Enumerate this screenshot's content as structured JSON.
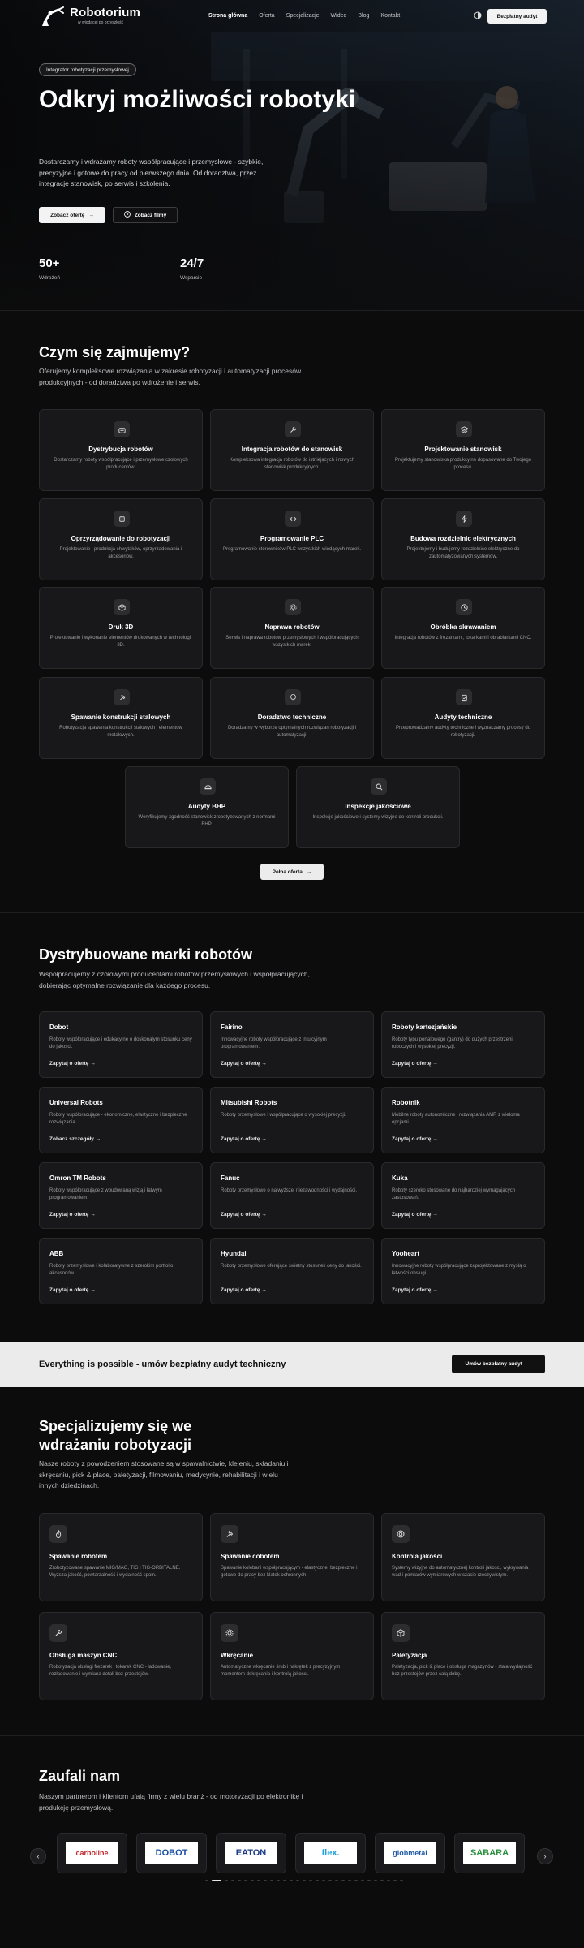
{
  "nav": {
    "logo_title": "Robotorium",
    "logo_sub": "w wiodącej po przyszłość",
    "links": [
      "Strona główna",
      "Oferta",
      "Specjalizacje",
      "Wideo",
      "Blog",
      "Kontakt"
    ],
    "cta": "Bezpłatny audyt"
  },
  "hero": {
    "badge": "Integrator robotyzacji przemysłowej",
    "title": "Odkryj możliwości robotyki",
    "description": "Dostarczamy i wdrażamy roboty współpracujące i przemysłowe - szybkie, precyzyjne i gotowe do pracy od pierwszego dnia. Od doradztwa, przez integrację stanowisk, po serwis i szkolenia.",
    "btn_offer": "Zobacz ofertę",
    "btn_video": "Zobacz filmy",
    "stats": [
      {
        "value": "50+",
        "label": "Wdrożeń"
      },
      {
        "value": "24/7",
        "label": "Wsparcie"
      }
    ]
  },
  "services": {
    "title": "Czym się zajmujemy?",
    "description": "Oferujemy kompleksowe rozwiązania w zakresie robotyzacji i automatyzacji procesów produkcyjnych - od doradztwa po wdrożenie i serwis.",
    "items": [
      {
        "title": "Dystrybucja robotów",
        "desc": "Dostarczamy roboty współpracujące i przemysłowe czołowych producentów.",
        "icon": "robot-icon"
      },
      {
        "title": "Integracja robotów do stanowisk",
        "desc": "Kompleksowa integracja robotów do istniejących i nowych stanowisk produkcyjnych.",
        "icon": "wrench-icon"
      },
      {
        "title": "Projektowanie stanowisk",
        "desc": "Projektujemy stanowiska produkcyjne dopasowane do Twojego procesu.",
        "icon": "layers-icon"
      },
      {
        "title": "Oprzyrządowanie do robotyzacji",
        "desc": "Projektowanie i produkcja chwytaków, oprzyrządowania i akcesoriów.",
        "icon": "cpu-icon"
      },
      {
        "title": "Programowanie PLC",
        "desc": "Programowanie sterowników PLC wszystkich wiodących marek.",
        "icon": "code-icon"
      },
      {
        "title": "Budowa rozdzielnic elektrycznych",
        "desc": "Projektujemy i budujemy rozdzielnice elektryczne do zautomatyzowanych systemów.",
        "icon": "bolt-icon"
      },
      {
        "title": "Druk 3D",
        "desc": "Projektowanie i wykonanie elementów drukowanych w technologii 3D.",
        "icon": "cube-icon"
      },
      {
        "title": "Naprawa robotów",
        "desc": "Serwis i naprawa robotów przemysłowych i współpracujących wszystkich marek.",
        "icon": "gear-icon"
      },
      {
        "title": "Obróbka skrawaniem",
        "desc": "Integracja robotów z frezarkami, tokarkami i obrabiarkami CNC.",
        "icon": "clock-icon"
      },
      {
        "title": "Spawanie konstrukcji stalowych",
        "desc": "Robotyzacja spawania konstrukcji stalowych i elementów metalowych.",
        "icon": "hammer-icon"
      },
      {
        "title": "Doradztwo techniczne",
        "desc": "Doradzamy w wyborze optymalnych rozwiązań robotyzacji i automatyzacji.",
        "icon": "lightbulb-icon"
      },
      {
        "title": "Audyty techniczne",
        "desc": "Przeprowadzamy audyty techniczne i wyznaczamy procesy do robotyzacji.",
        "icon": "clipboard-icon"
      },
      {
        "title": "Audyty BHP",
        "desc": "Weryfikujemy zgodność stanowisk zrobotyzowanych z normami BHP.",
        "icon": "helmet-icon"
      },
      {
        "title": "Inspekcje jakościowe",
        "desc": "Inspekcje jakościowe i systemy wizyjne do kontroli produkcji.",
        "icon": "search-icon"
      }
    ],
    "full_offer": "Pełna oferta"
  },
  "brands": {
    "title": "Dystrybuowane marki robotów",
    "description": "Współpracujemy z czołowymi producentami robotów przemysłowych i współpracujących, dobierając optymalne rozwiązanie dla każdego procesu.",
    "items": [
      {
        "name": "Dobot",
        "desc": "Roboty współpracujące i edukacyjne o doskonałym stosunku ceny do jakości.",
        "link": "Zapytaj o ofertę"
      },
      {
        "name": "Fairino",
        "desc": "Innowacyjne roboty współpracujące z intuicyjnym programowaniem.",
        "link": "Zapytaj o ofertę"
      },
      {
        "name": "Roboty kartezjańskie",
        "desc": "Roboty typu portalowego (gantry) do dużych przestrzeni roboczych i wysokiej precyzji.",
        "link": "Zapytaj o ofertę"
      },
      {
        "name": "Universal Robots",
        "desc": "Roboty współpracujące - ekonomiczne, elastyczne i bezpieczne rozwiązania.",
        "link": "Zobacz szczegóły"
      },
      {
        "name": "Mitsubishi Robots",
        "desc": "Roboty przemysłowe i współpracujące o wysokiej precyzji.",
        "link": "Zapytaj o ofertę"
      },
      {
        "name": "Robotnik",
        "desc": "Mobilne roboty autonomiczne i rozwiązania AMR z wieloma opcjami.",
        "link": "Zapytaj o ofertę"
      },
      {
        "name": "Omron TM Robots",
        "desc": "Roboty współpracujące z wbudowaną wizją i łatwym programowaniem.",
        "link": "Zapytaj o ofertę"
      },
      {
        "name": "Fanuc",
        "desc": "Roboty przemysłowe o najwyższej niezawodności i wydajności.",
        "link": "Zapytaj o ofertę"
      },
      {
        "name": "Kuka",
        "desc": "Roboty szeroko stosowane do najbardziej wymagających zastosowań.",
        "link": "Zapytaj o ofertę"
      },
      {
        "name": "ABB",
        "desc": "Roboty przemysłowe i kolaboratywne z szerokim portfolio akcesoriów.",
        "link": "Zapytaj o ofertę"
      },
      {
        "name": "Hyundai",
        "desc": "Roboty przemysłowe oferujące świetny stosunek ceny do jakości.",
        "link": "Zapytaj o ofertę"
      },
      {
        "name": "Yooheart",
        "desc": "Innowacyjne roboty współpracujące zaprojektowane z myślą o łatwości obsługi.",
        "link": "Zapytaj o ofertę"
      }
    ]
  },
  "banner": {
    "text": "Everything is possible - umów bezpłatny audyt techniczny",
    "cta": "Umów bezpłatny audyt"
  },
  "specializations": {
    "title": "Specjalizujemy się we wdrażaniu robotyzacji",
    "description": "Nasze roboty z powodzeniem stosowane są w spawalnictwie, klejeniu, składaniu i skręcaniu, pick & place, paletyzacji, filmowaniu, medycynie, rehabilitacji i wielu innych dziedzinach.",
    "items": [
      {
        "title": "Spawanie robotem",
        "desc": "Zrobotyzowane spawanie MIG/MAG, TIG i TIG-ORBITALNE. Wyższa jakość, powtarzalność i wydajność spoin.",
        "icon": "flame-icon"
      },
      {
        "title": "Spawanie cobotem",
        "desc": "Spawanie kolebani współpracującym - elastyczne, bezpieczne i gotowe do pracy bez klatek ochronnych.",
        "icon": "hammer-icon"
      },
      {
        "title": "Kontrola jakości",
        "desc": "Systemy wizyjne do automatycznej kontroli jakości, wykrywania wad i pomiarów wymiarowych w czasie rzeczywistym.",
        "icon": "target-icon"
      },
      {
        "title": "Obsługa maszyn CNC",
        "desc": "Robotyzacja obsługi frezarek i tokarek CNC - ładowanie, rozładowanie i wymiana detali bez przestojów.",
        "icon": "wrench-icon"
      },
      {
        "title": "Wkręcanie",
        "desc": "Automatyczne wkręcanie śrub i nakrętek z precyzyjnym momentem dokręcania i kontrolą jakości.",
        "icon": "gear-icon"
      },
      {
        "title": "Paletyzacja",
        "desc": "Paletyzacja, pick & place i obsługa magazynów - stała wydajność bez przestojów przez całą dobę.",
        "icon": "box-icon"
      }
    ]
  },
  "partners": {
    "title": "Zaufali nam",
    "description": "Naszym partnerom i klientom ufają firmy z wielu branż - od motoryzacji po elektronikę i produkcję przemysłową.",
    "logos": [
      {
        "name": "carboline",
        "color": "#c0282c"
      },
      {
        "name": "DOBOT",
        "color": "#1a4fa3"
      },
      {
        "name": "EATON",
        "color": "#1b3b8a"
      },
      {
        "name": "flex.",
        "color": "#1da1d8"
      },
      {
        "name": "globmetal",
        "color": "#1f5aa6"
      },
      {
        "name": "SABARA",
        "color": "#2a8f3c"
      }
    ],
    "slide_count": 30,
    "active_slide": 1
  }
}
